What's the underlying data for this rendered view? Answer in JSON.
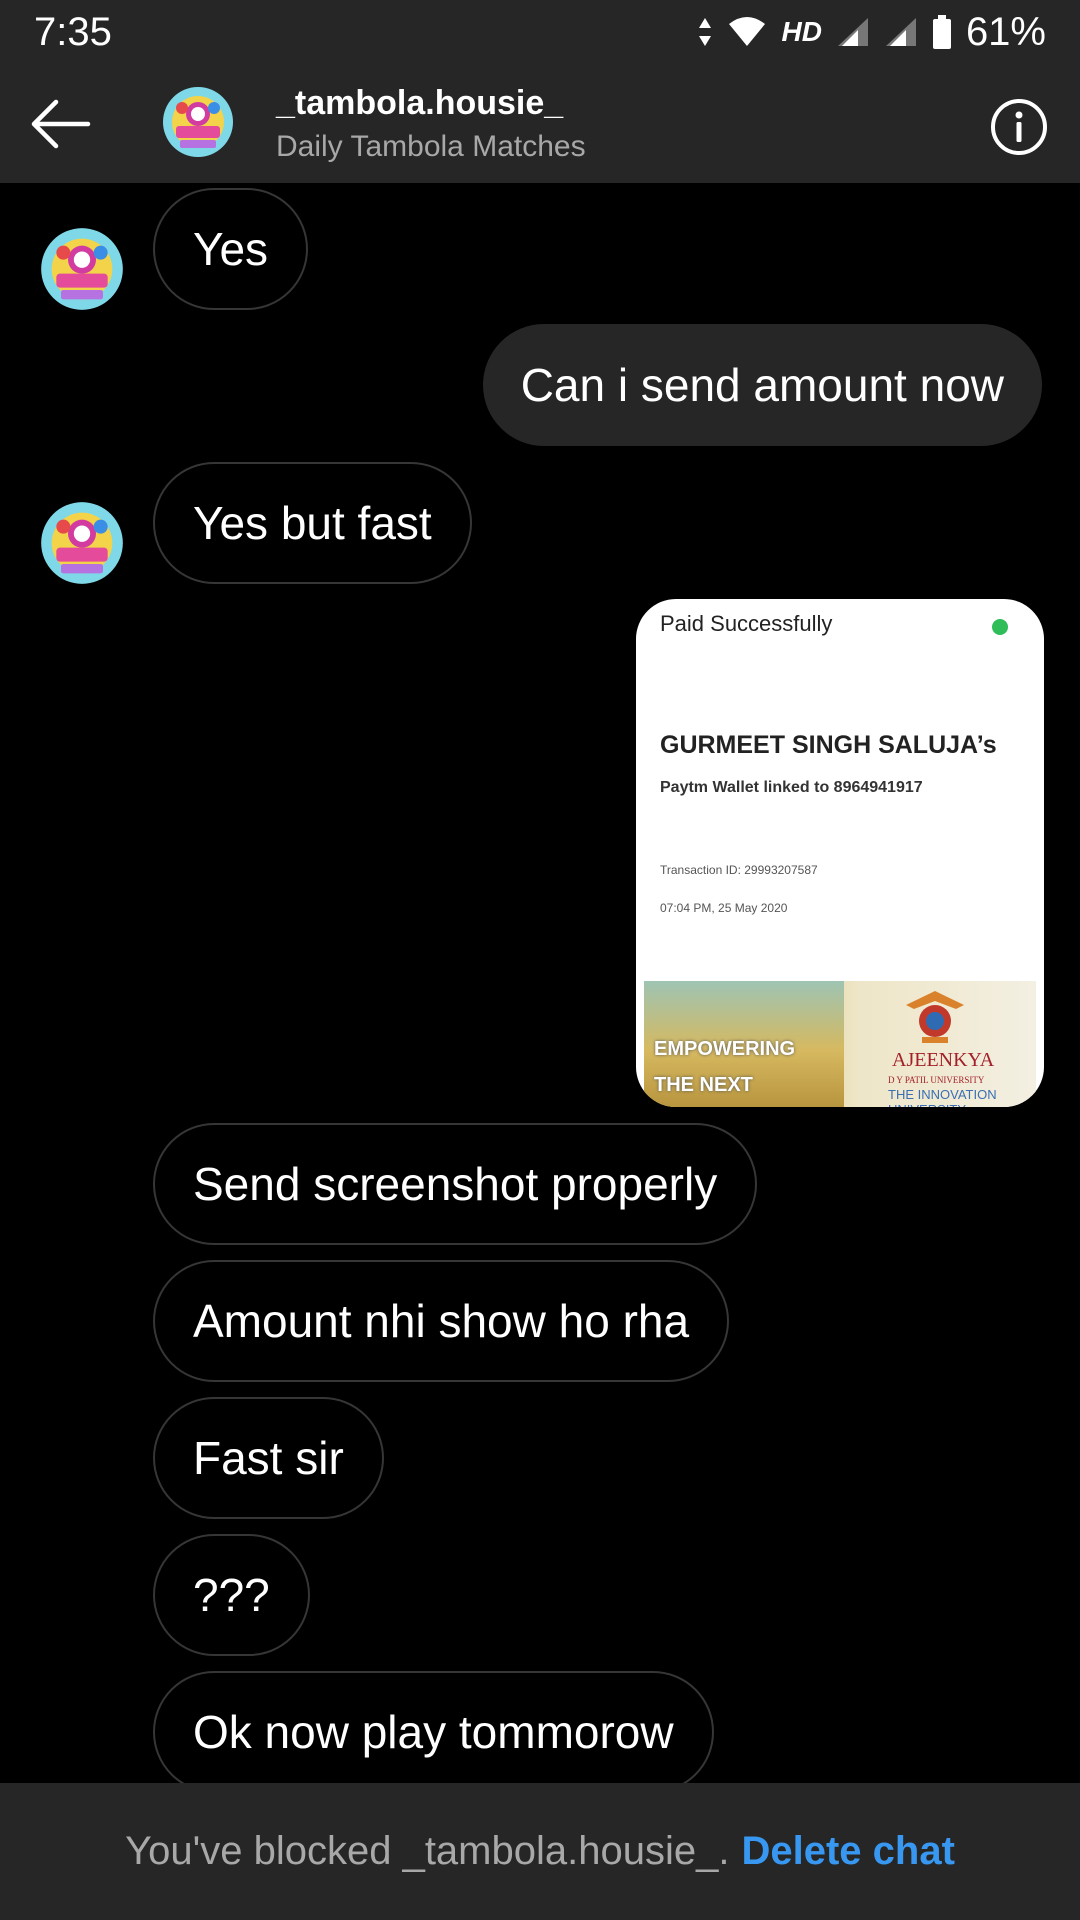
{
  "status_bar": {
    "time": "7:35",
    "network": "HD",
    "battery": "61%"
  },
  "header": {
    "username": "_tambola.housie_",
    "subtitle": "Daily Tambola Matches"
  },
  "messages": [
    {
      "text": "Yes"
    },
    {
      "text": "Can i send amount now"
    },
    {
      "text": "Yes but fast"
    },
    {
      "text": "Send screenshot properly"
    },
    {
      "text": "Amount nhi show ho rha"
    },
    {
      "text": "Fast sir"
    },
    {
      "text": "???"
    },
    {
      "text": "Ok now play tommorow"
    }
  ],
  "receipt": {
    "status": "Paid Successfully",
    "name": "GURMEET SINGH SALUJA’s",
    "wallet": "Paytm Wallet linked to 8964941917",
    "transaction": "Transaction ID: 29993207587",
    "datetime": "07:04 PM, 25 May 2020",
    "banner_line1": "EMPOWERING",
    "banner_line2": "THE NEXT",
    "banner_uni": "AJEENKYA",
    "banner_uni_sub": "D Y PATIL UNIVERSITY",
    "banner_tagline": "THE INNOVATION UNIVERSITY"
  },
  "footer": {
    "blocked_text": "You've blocked _tambola.housie_.",
    "delete_label": "Delete chat"
  },
  "colors": {
    "link": "#3897f0",
    "bar": "#262626",
    "bubble_border": "#363636"
  }
}
